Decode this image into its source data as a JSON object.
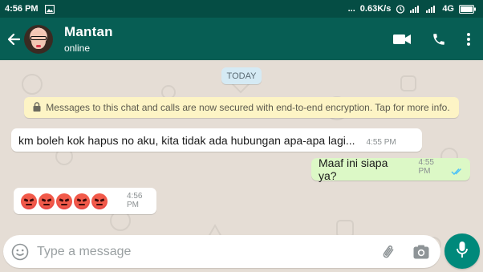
{
  "status_bar": {
    "time": "4:56 PM",
    "more": "...",
    "speed": "0.63K/s",
    "network": "4G"
  },
  "header": {
    "contact_name": "Mantan",
    "contact_status": "online"
  },
  "chat": {
    "date_chip": "TODAY",
    "encryption_notice": "Messages to this chat and calls are now secured with end-to-end encryption. Tap for more info.",
    "messages": [
      {
        "direction": "incoming",
        "text": "km boleh kok hapus no aku, kita tidak ada hubungan apa-apa lagi...",
        "time": "4:55 PM"
      },
      {
        "direction": "outgoing",
        "text": "Maaf ini siapa ya?",
        "time": "4:55 PM",
        "status": "read"
      },
      {
        "direction": "incoming",
        "emoji": "angry-face",
        "emoji_count": 5,
        "time": "4:56 PM"
      }
    ]
  },
  "composer": {
    "placeholder": "Type a message"
  },
  "colors": {
    "header": "#075e54",
    "status_bar": "#054d44",
    "outgoing_bubble": "#dcf8c6",
    "mic_button": "#00897b"
  }
}
